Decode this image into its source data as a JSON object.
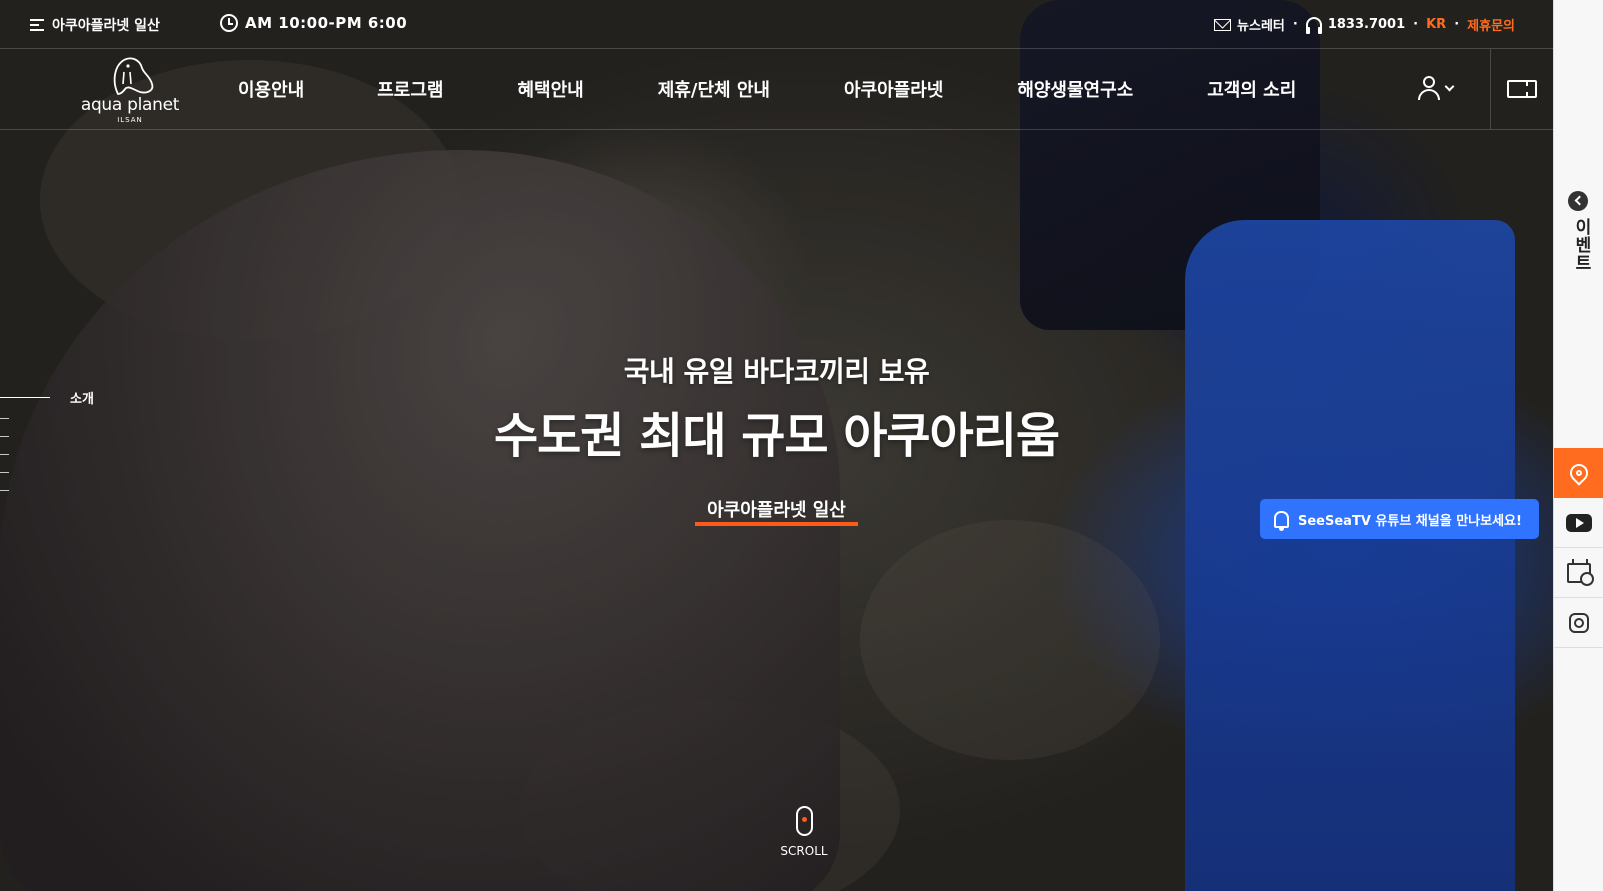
{
  "topbar": {
    "menu_label": "아쿠아플라넷 일산",
    "hours": "AM 10:00-PM 6:00",
    "newsletter": "뉴스레터",
    "phone": "1833.7001",
    "lang": "KR",
    "partnership": "제휴문의"
  },
  "logo": {
    "brand": "aqua planet",
    "location": "ILSAN"
  },
  "nav": {
    "items": [
      {
        "label": "이용안내"
      },
      {
        "label": "프로그램"
      },
      {
        "label": "혜택안내"
      },
      {
        "label": "제휴/단체 안내"
      },
      {
        "label": "아쿠아플라넷"
      },
      {
        "label": "해양생물연구소"
      },
      {
        "label": "고객의 소리"
      }
    ]
  },
  "section_nav": {
    "active_label": "소개"
  },
  "hero": {
    "subtitle": "국내 유일 바다코끼리 보유",
    "title": "수도권 최대 규모 아쿠아리움",
    "link": "아쿠아플라넷 일산"
  },
  "youtube_bubble": {
    "text": "SeeSeaTV 유튜브 채널을 만나보세요!"
  },
  "sidebar": {
    "event_label": "이벤트",
    "quick_links": [
      {
        "icon": "location-pin-icon"
      },
      {
        "icon": "youtube-icon"
      },
      {
        "icon": "calendar-icon"
      },
      {
        "icon": "instagram-icon"
      }
    ]
  },
  "scroll": {
    "label": "SCROLL"
  },
  "colors": {
    "accent": "#ff6b1f",
    "bubble": "#2f73ff",
    "sidebar_bg": "#f7f7f7"
  }
}
